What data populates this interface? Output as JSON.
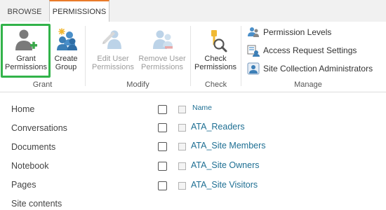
{
  "tabs": [
    {
      "label": "BROWSE"
    },
    {
      "label": "PERMISSIONS"
    }
  ],
  "ribbon": {
    "grant_permissions": "Grant Permissions",
    "create_group": "Create Group",
    "edit_user_permissions": "Edit User Permissions",
    "remove_user_permissions": "Remove User Permissions",
    "check_permissions": "Check Permissions",
    "permission_levels": "Permission Levels",
    "access_request_settings": "Access Request Settings",
    "site_collection_administrators": "Site Collection Administrators",
    "groups": {
      "grant": "Grant",
      "modify": "Modify",
      "check": "Check",
      "manage": "Manage"
    }
  },
  "nav": [
    "Home",
    "Conversations",
    "Documents",
    "Notebook",
    "Pages",
    "Site contents"
  ],
  "list": {
    "column_header": "Name",
    "rows": [
      "ATA_Readers",
      "ATA_Site Members",
      "ATA_Site Owners",
      "ATA_Site Visitors"
    ]
  },
  "colors": {
    "accent_tab": "#e97b2a",
    "highlight": "#32b34a",
    "link": "#1e6f93"
  }
}
